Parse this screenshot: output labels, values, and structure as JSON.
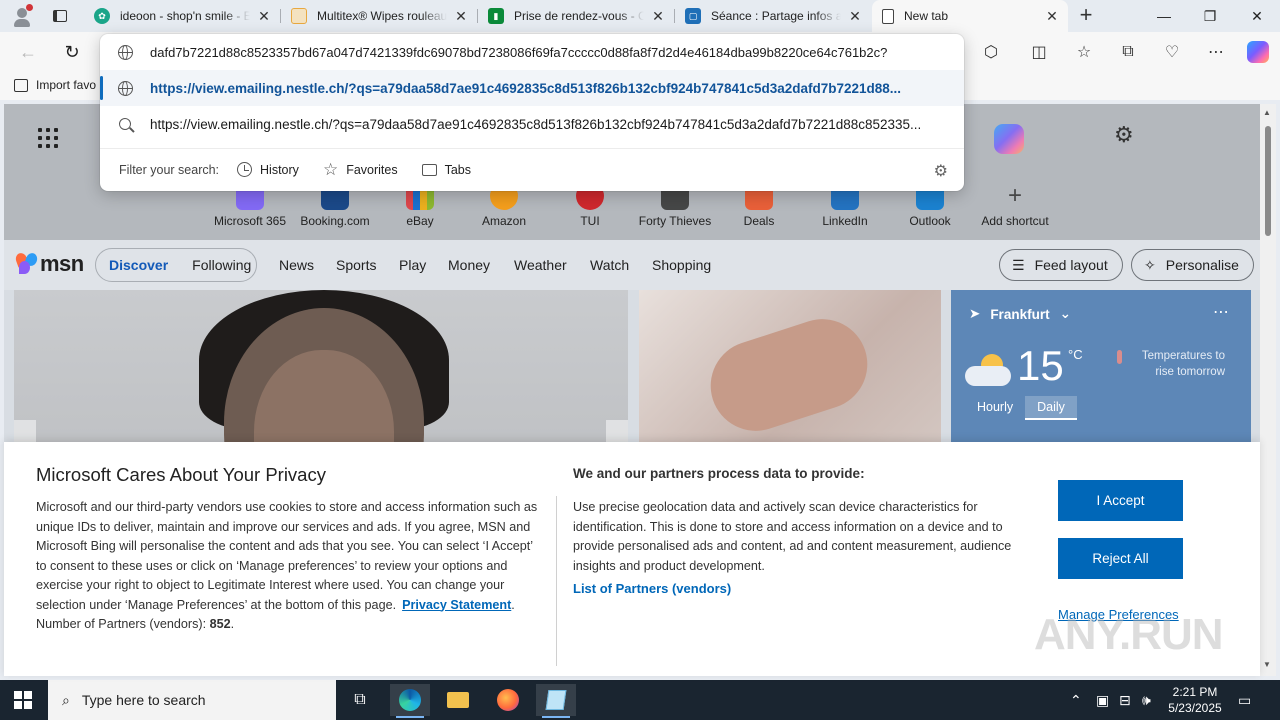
{
  "tabs": [
    {
      "title": "ideoon - shop'n smile - E",
      "favicon_color": "#1aa589"
    },
    {
      "title": "Multitex® Wipes rouleau",
      "favicon_color": "#e8a840"
    },
    {
      "title": "Prise de rendez-vous - Ca",
      "favicon_color": "#0b8a3a"
    },
    {
      "title": "Séance : Partage infos ac",
      "favicon_color": "#1f6fb7"
    },
    {
      "title": "New tab",
      "favicon_color": "#555555"
    }
  ],
  "address": {
    "value": "?dafd7b7221d88c8523357bd67a047d7421339fdc69078bd7238086f69fa7ccccc0d88fa8f7d2d4e46184dba99b8220ce64c761b2c",
    "suggestion_url": "https://view.emailing.nestle.ch/?qs=a79daa58d7ae91c4692835c8d513f826b132cbf924b747841c5d3a2dafd7b7221d88...",
    "suggestion_search": "https://view.emailing.nestle.ch/?qs=a79daa58d7ae91c4692835c8d513f826b132cbf924b747841c5d3a2dafd7b7221d88c852335...",
    "filter_label": "Filter your search:",
    "filter_history": "History",
    "filter_favorites": "Favorites",
    "filter_tabs": "Tabs"
  },
  "favbar": {
    "import_label": "Import favo"
  },
  "shortcuts": [
    {
      "label": "Microsoft 365",
      "color": "#7a5cff"
    },
    {
      "label": "Booking.com",
      "color": "#003580"
    },
    {
      "label": "eBay",
      "color": "#e53238"
    },
    {
      "label": "Amazon",
      "color": "#ff9900"
    },
    {
      "label": "TUI",
      "color": "#d40e14"
    },
    {
      "label": "Forty Thieves",
      "color": "#333333"
    },
    {
      "label": "Deals",
      "color": "#f25022"
    },
    {
      "label": "LinkedIn",
      "color": "#0a66c2"
    },
    {
      "label": "Outlook",
      "color": "#0078d4"
    },
    {
      "label": "Add shortcut",
      "color": "transparent"
    }
  ],
  "msn": {
    "logo": "msn",
    "discover": "Discover",
    "following": "Following",
    "nav": [
      "News",
      "Sports",
      "Play",
      "Money",
      "Weather",
      "Watch",
      "Shopping"
    ],
    "feed_layout": "Feed layout",
    "personalise": "Personalise"
  },
  "weather": {
    "city": "Frankfurt",
    "temp": "15",
    "unit": "°C",
    "forecast_line1": "Temperatures to",
    "forecast_line2": "rise tomorrow",
    "tab_hourly": "Hourly",
    "tab_daily": "Daily"
  },
  "privacy": {
    "title": "Microsoft Cares About Your Privacy",
    "body": "Microsoft and our third-party vendors use cookies to store and access information such as unique IDs to deliver, maintain and improve our services and ads. If you agree, MSN and Microsoft Bing will personalise the content and ads that you see. You can select ‘I Accept’ to consent to these uses or click on ‘Manage preferences’ to review your options and exercise your right to object to Legitimate Interest where used.  You can change your selection under ‘Manage Preferences’ at the bottom of this page.",
    "privacy_link": "Privacy Statement",
    "partners_label": "Number of Partners (vendors):",
    "partners_count": "852",
    "right_title": "We and our partners process data to provide:",
    "right_body": "Use precise geolocation data and actively scan device characteristics for identification. This is done to store and access information on a device and to provide personalised ads and content, ad and content measurement, audience insights and product development.",
    "partners_link": "List of Partners (vendors)",
    "accept": "I Accept",
    "reject": "Reject All",
    "manage": "Manage Preferences",
    "watermark": "ANY.RUN"
  },
  "taskbar": {
    "search_placeholder": "Type here to search",
    "time": "2:21 PM",
    "date": "5/23/2025"
  }
}
